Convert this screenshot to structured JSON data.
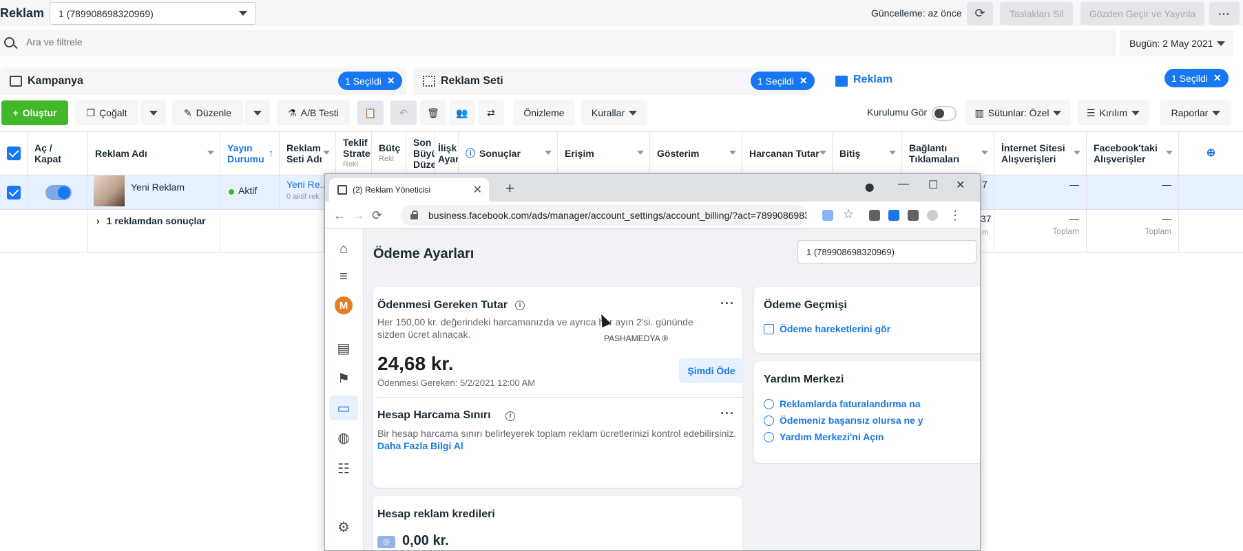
{
  "header": {
    "title": "Reklam",
    "account": "1 (789908698320969)",
    "updated": "Güncelleme: az önce",
    "delete_drafts": "Taslakları Sil",
    "review_publish": "Gözden Geçir ve Yayınla",
    "more": "···"
  },
  "search": {
    "placeholder": "Ara ve filtrele",
    "date": "Bugün: 2 May 2021"
  },
  "levels": [
    {
      "label": "Kampanya",
      "selected": "1 Seçildi"
    },
    {
      "label": "Reklam Seti",
      "selected": "1 Seçildi"
    },
    {
      "label": "Reklam",
      "selected": "1 Seçildi"
    }
  ],
  "toolbar": {
    "create": "Oluştur",
    "duplicate": "Çoğalt",
    "edit": "Düzenle",
    "ab_test": "A/B Testi",
    "preview": "Önizleme",
    "rules": "Kurallar",
    "setup_view": "Kurulumu Gör",
    "columns": "Sütunlar: Özel",
    "breakdown": "Kırılım",
    "reports": "Raporlar"
  },
  "table": {
    "headers": {
      "onoff": "Aç / Kapat",
      "ad_name": "Reklam Adı",
      "delivery": "Yayın Durumu",
      "adset_name": "Reklam Seti Adı",
      "bid": "Teklif Strate",
      "bid_sub": "Rekl",
      "budget": "Bütç",
      "budget_sub": "Rekl",
      "last_edit": "Son Büyü Düze",
      "attribution": "İlişk Ayar",
      "results": "Sonuçlar",
      "reach": "Erişim",
      "impressions": "Gösterim",
      "spent": "Harcanan Tutar",
      "ends": "Bitiş",
      "link_clicks": "Bağlantı Tıklamaları",
      "web_purchases": "İnternet Sitesi Alışverişleri",
      "fb_purchases": "Facebook'taki Alışverişler"
    },
    "row": {
      "ad_name": "Yeni Reklam",
      "delivery": "Aktif",
      "adset_name": "Yeni Re...",
      "adset_sub": "0 aktif rek",
      "link_clicks_tail": "7",
      "web_purchases": "—",
      "fb_purchases": "—"
    },
    "summary": {
      "label": "1 reklamdan sonuçlar",
      "link_clicks_tail": "37",
      "link_clicks_sub_tail": "m",
      "web_purchases": "—",
      "web_sub": "Toplam",
      "fb_purchases": "—",
      "fb_sub": "Toplam"
    }
  },
  "browser": {
    "tab_title": "(2) Reklam Yöneticisi",
    "url": "business.facebook.com/ads/manager/account_settings/account_billing/?act=7899086983..."
  },
  "billing": {
    "title": "Ödeme Ayarları",
    "account": "1 (789908698320969)",
    "due_title": "Ödenmesi Gereken Tutar",
    "due_desc": "Her 150,00 kr. değerindeki harcamanızda ve ayrıca her ayın 2'si. gününde sizden ücret alınacak.",
    "watermark": "PASHAMEDYA ®",
    "due_amount": "24,68 kr.",
    "due_date": "Ödenmesi Gereken: 5/2/2021 12:00 AM",
    "pay_now": "Şimdi Öde",
    "limit_title": "Hesap Harcama Sınırı",
    "limit_desc": "Bir hesap harcama sınırı belirleyerek toplam reklam ücretlerinizi kontrol edebilirsiniz.",
    "limit_link": "Daha Fazla Bilgi Al",
    "credits_title": "Hesap reklam kredileri",
    "credits_amount": "0,00 kr.",
    "history_title": "Ödeme Geçmişi",
    "history_link": "Ödeme hareketlerini gör",
    "help_title": "Yardım Merkezi",
    "help_links": [
      "Reklamlarda faturalandırma na",
      "Ödemeniz başarısız olursa ne y",
      "Yardım Merkezi'ni Açın"
    ],
    "avatar_letter": "M"
  },
  "colors": {
    "accent": "#1877f2",
    "create": "#42b72a",
    "row_selected": "#e7f0fe"
  }
}
